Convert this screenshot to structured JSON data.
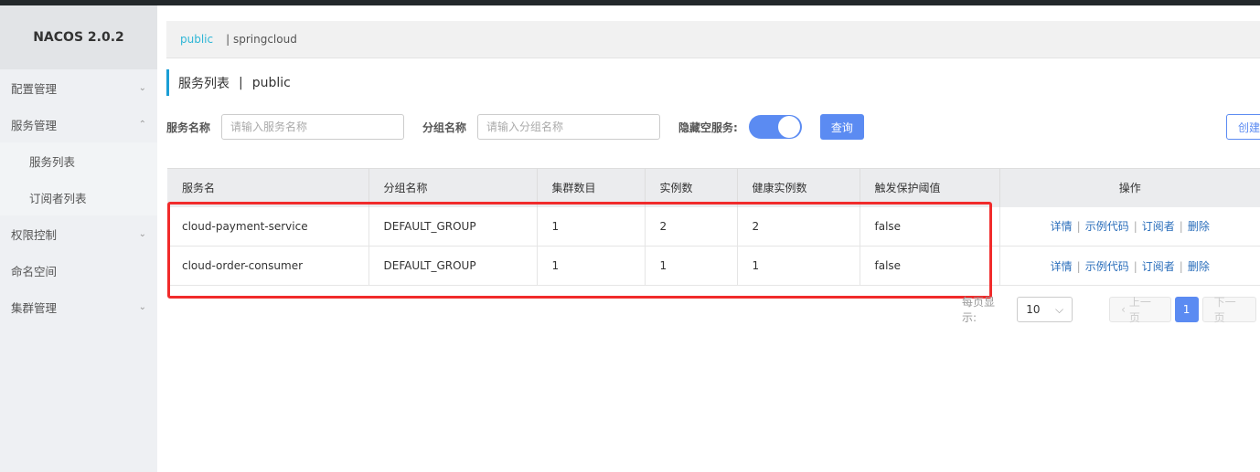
{
  "app": {
    "logo": "NACOS 2.0.2"
  },
  "sidebar": {
    "items": [
      {
        "label": "配置管理",
        "chevron": "⌄"
      },
      {
        "label": "服务管理",
        "chevron": "⌃"
      },
      {
        "label": "服务列表"
      },
      {
        "label": "订阅者列表"
      },
      {
        "label": "权限控制",
        "chevron": "⌄"
      },
      {
        "label": "命名空间"
      },
      {
        "label": "集群管理",
        "chevron": "⌄"
      }
    ]
  },
  "namespaces": {
    "active": "public",
    "other": "| springcloud"
  },
  "page": {
    "title": "服务列表",
    "sep": "|",
    "ns": "public"
  },
  "filters": {
    "service_label": "服务名称",
    "service_placeholder": "请输入服务名称",
    "group_label": "分组名称",
    "group_placeholder": "请输入分组名称",
    "hide_empty_label": "隐藏空服务:",
    "hide_empty": true,
    "query": "查询",
    "create": "创建服务"
  },
  "table": {
    "headers": [
      "服务名",
      "分组名称",
      "集群数目",
      "实例数",
      "健康实例数",
      "触发保护阈值",
      "操作"
    ],
    "rows": [
      [
        "cloud-payment-service",
        "DEFAULT_GROUP",
        "1",
        "2",
        "2",
        "false"
      ],
      [
        "cloud-order-consumer",
        "DEFAULT_GROUP",
        "1",
        "1",
        "1",
        "false"
      ]
    ],
    "actions": [
      "详情",
      "示例代码",
      "订阅者",
      "删除"
    ],
    "sep": "|"
  },
  "pagination": {
    "per_page_label": "每页显示:",
    "per_page": "10",
    "prev": "上一页",
    "current": "1",
    "next": "下一页"
  }
}
